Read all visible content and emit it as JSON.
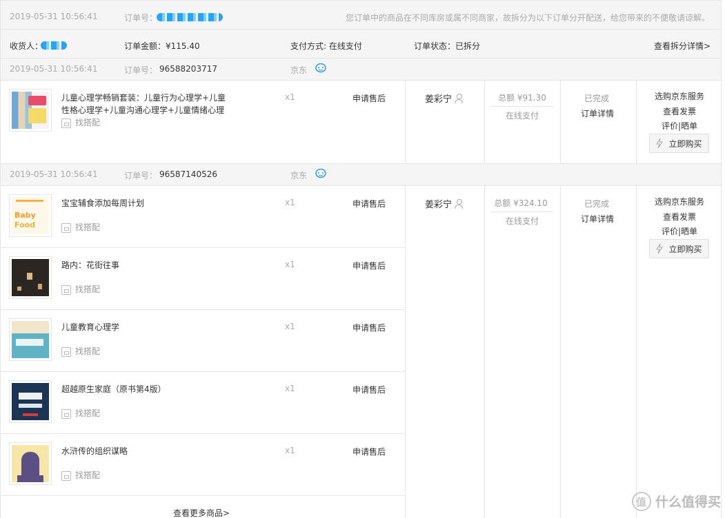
{
  "top": {
    "date": "2019-05-31 10:56:41",
    "order_label": "订单号：",
    "notice": "您订单中的商品在不同库房或属不同商家，故拆分为以下订单分开配送，给您带来的不便敬请谅解。"
  },
  "summary": {
    "receiver_label": "收货人：",
    "amount": "订单金额：¥115.40",
    "payment": "支付方式: 在线支付",
    "status": "订单状态：已拆分",
    "split_link": "查看拆分详情>"
  },
  "orders": [
    {
      "date": "2019-05-31 10:56:41",
      "order_label": "订单号：",
      "order_no": "96588203717",
      "shop": "京东",
      "user": "姜彩宁",
      "total": "总额 ¥91.30",
      "pay": "在线支付",
      "status": "已完成",
      "detail": "订单详情",
      "ops": [
        "选购京东服务",
        "查看发票"
      ],
      "review": "评价|晒单",
      "buy": "立即购买",
      "items": [
        {
          "name": "儿童心理学畅销套装：儿童行为心理学+儿童性格心理学+儿童沟通心理学+儿童情绪心理",
          "qty": "x1",
          "after": "申请售后",
          "pair": "找搭配"
        }
      ]
    },
    {
      "date": "2019-05-31 10:56:41",
      "order_label": "订单号：",
      "order_no": "96587140526",
      "shop": "京东",
      "user": "姜彩宁",
      "total": "总额 ¥324.10",
      "pay": "在线支付",
      "status": "已完成",
      "detail": "订单详情",
      "ops": [
        "选购京东服务",
        "查看发票"
      ],
      "review": "评价|晒单",
      "buy": "立即购买",
      "items": [
        {
          "name": "宝宝辅食添加每周计划",
          "qty": "x1",
          "after": "申请售后",
          "pair": "找搭配"
        },
        {
          "name": "路内：花街往事",
          "qty": "x1",
          "after": "申请售后",
          "pair": "找搭配"
        },
        {
          "name": "儿童教育心理学",
          "qty": "x1",
          "after": "申请售后",
          "pair": "找搭配"
        },
        {
          "name": "超越原生家庭（原书第4版）",
          "qty": "x1",
          "after": "申请售后",
          "pair": "找搭配"
        },
        {
          "name": "水浒传的组织谋略",
          "qty": "x1",
          "after": "申请售后",
          "pair": "找搭配"
        }
      ],
      "more": "查看更多商品>"
    }
  ],
  "watermark": "什么值得买",
  "colors": {
    "border": "#e5e5e5",
    "header_bg": "#f5f5f5",
    "muted": "#999999",
    "redact": "#2aa4ee"
  }
}
